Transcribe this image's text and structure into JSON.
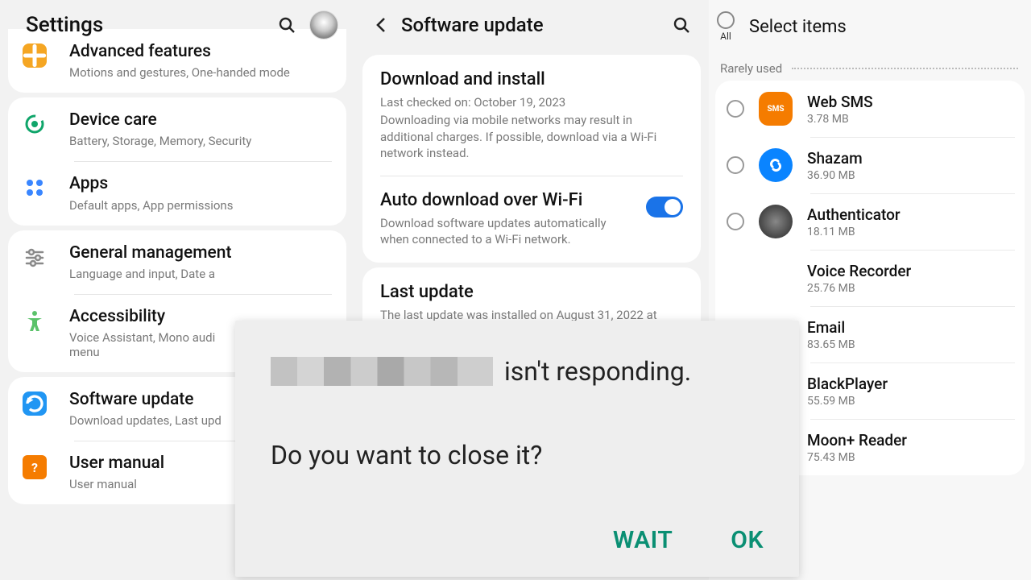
{
  "settings": {
    "title": "Settings",
    "items": [
      {
        "title": "Advanced features",
        "sub": "Motions and gestures, One-handed mode"
      },
      {
        "title": "Device care",
        "sub": "Battery, Storage, Memory, Security"
      },
      {
        "title": "Apps",
        "sub": "Default apps, App permissions"
      },
      {
        "title": "General management",
        "sub": "Language and input, Date a"
      },
      {
        "title": "Accessibility",
        "sub": "Voice Assistant, Mono audi\nmenu"
      },
      {
        "title": "Software update",
        "sub": "Download updates, Last upd"
      },
      {
        "title": "User manual",
        "sub": "User manual"
      }
    ]
  },
  "software_update": {
    "header": "Software update",
    "download": {
      "title": "Download and install",
      "sub1": "Last checked on: October 19, 2023",
      "sub2": "Downloading via mobile networks may result in additional charges. If possible, download via a Wi-Fi network instead."
    },
    "auto": {
      "title": "Auto download over Wi-Fi",
      "sub": "Download software updates automatically when connected to a Wi-Fi network.",
      "enabled": true
    },
    "last": {
      "title": "Last update",
      "sub": "The last update was installed on August 31, 2022 at"
    }
  },
  "select": {
    "title": "Select items",
    "all_label": "All",
    "section": "Rarely used",
    "apps": [
      {
        "name": "Web SMS",
        "size": "3.78 MB",
        "color": "#f57c00"
      },
      {
        "name": "Shazam",
        "size": "36.90 MB",
        "color": "#0a84ff"
      },
      {
        "name": "Authenticator",
        "size": "18.11 MB",
        "color": "#5f5f5f"
      },
      {
        "name": "Voice Recorder",
        "size": "25.76 MB",
        "color": "#e91e3a"
      },
      {
        "name": "Email",
        "size": "83.65 MB",
        "color": "#ffffff"
      },
      {
        "name": "BlackPlayer",
        "size": "55.59 MB",
        "color": "#ffffff"
      },
      {
        "name": "Moon+ Reader",
        "size": "75.43 MB",
        "color": "#ffffff"
      }
    ]
  },
  "dialog": {
    "line1_suffix": "isn't responding.",
    "line2": "Do you want to close it?",
    "wait": "WAIT",
    "ok": "OK"
  }
}
